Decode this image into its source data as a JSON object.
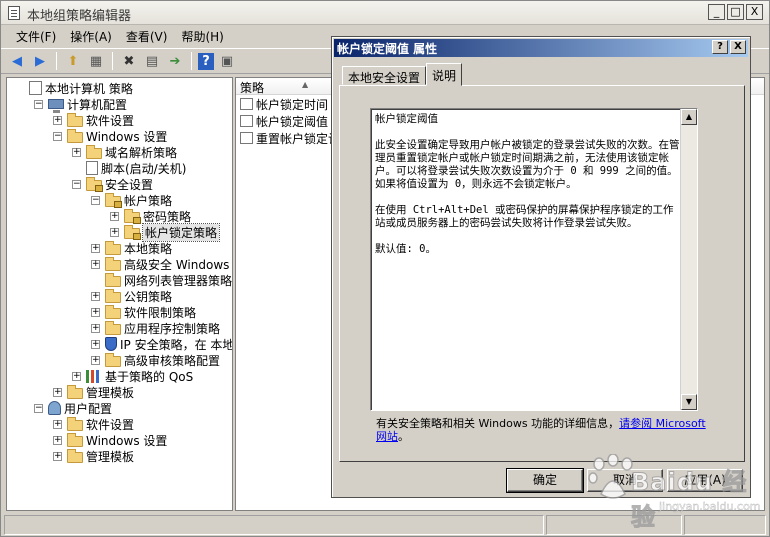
{
  "window": {
    "title": "本地组策略编辑器",
    "controls": [
      "_",
      "□",
      "X"
    ]
  },
  "menu": [
    "文件(F)",
    "操作(A)",
    "查看(V)",
    "帮助(H)"
  ],
  "tree": {
    "rows": [
      {
        "label": "本地计算机 策略",
        "icon": "policy-icon",
        "exp": ""
      },
      {
        "label": "计算机配置",
        "icon": "computer-icon",
        "exp": "−"
      },
      {
        "label": "软件设置",
        "icon": "folder-icon",
        "exp": "+"
      },
      {
        "label": "Windows 设置",
        "icon": "folder-icon",
        "exp": "−"
      },
      {
        "label": "域名解析策略",
        "icon": "folder-icon",
        "exp": "+"
      },
      {
        "label": "脚本(启动/关机)",
        "icon": "script-icon",
        "exp": ""
      },
      {
        "label": "安全设置",
        "icon": "lock-folder-icon",
        "exp": "−"
      },
      {
        "label": "帐户策略",
        "icon": "lock-folder-icon",
        "exp": "−"
      },
      {
        "label": "密码策略",
        "icon": "lock-folder-icon",
        "exp": "+"
      },
      {
        "label": "帐户锁定策略",
        "icon": "lock-folder-icon",
        "exp": "+",
        "selected": true
      },
      {
        "label": "本地策略",
        "icon": "folder-icon",
        "exp": "+"
      },
      {
        "label": "高级安全 Windows 防火",
        "icon": "folder-icon",
        "exp": "+"
      },
      {
        "label": "网络列表管理器策略",
        "icon": "folder-icon",
        "exp": ""
      },
      {
        "label": "公钥策略",
        "icon": "folder-icon",
        "exp": "+"
      },
      {
        "label": "软件限制策略",
        "icon": "folder-icon",
        "exp": "+"
      },
      {
        "label": "应用程序控制策略",
        "icon": "folder-icon",
        "exp": "+"
      },
      {
        "label": "IP 安全策略，在 本地",
        "icon": "shield-icon",
        "exp": "+"
      },
      {
        "label": "高级审核策略配置",
        "icon": "folder-icon",
        "exp": "+"
      },
      {
        "label": "基于策略的 QoS",
        "icon": "chart-icon",
        "exp": "+"
      },
      {
        "label": "管理模板",
        "icon": "folder-icon",
        "exp": "+"
      },
      {
        "label": "用户配置",
        "icon": "user-icon",
        "exp": "−"
      },
      {
        "label": "软件设置",
        "icon": "folder-icon",
        "exp": "+"
      },
      {
        "label": "Windows 设置",
        "icon": "folder-icon",
        "exp": "+"
      },
      {
        "label": "管理模板",
        "icon": "folder-icon",
        "exp": "+"
      }
    ]
  },
  "list": {
    "header": "策略",
    "items": [
      "帐户锁定时间",
      "帐户锁定阈值",
      "重置帐户锁定计"
    ]
  },
  "dialog": {
    "title": "帐户锁定阈值 属性",
    "controls": [
      "?",
      "X"
    ],
    "tabs": [
      "本地安全设置",
      "说明"
    ],
    "active_tab": "说明",
    "explain": {
      "heading": "帐户锁定阈值",
      "para1": "此安全设置确定导致用户帐户被锁定的登录尝试失败的次数。在管理员重置锁定帐户或帐户锁定时间期满之前，无法使用该锁定帐户。可以将登录尝试失败次数设置为介于 0 和 999 之间的值。如果将值设置为 0，则永远不会锁定帐户。",
      "para2": "在使用 Ctrl+Alt+Del 或密码保护的屏幕保护程序锁定的工作站或成员服务器上的密码尝试失败将计作登录尝试失败。",
      "para3": "默认值: 0。"
    },
    "footer_text": "有关安全策略和相关 Windows 功能的详细信息，",
    "footer_link": "请参阅 Microsoft 网站",
    "footer_end": "。",
    "buttons": {
      "ok": "确定",
      "cancel": "取消",
      "apply": "应用(A)"
    }
  },
  "watermark": {
    "text": "Baidu 经验",
    "url": "jingyan.baidu.com"
  }
}
